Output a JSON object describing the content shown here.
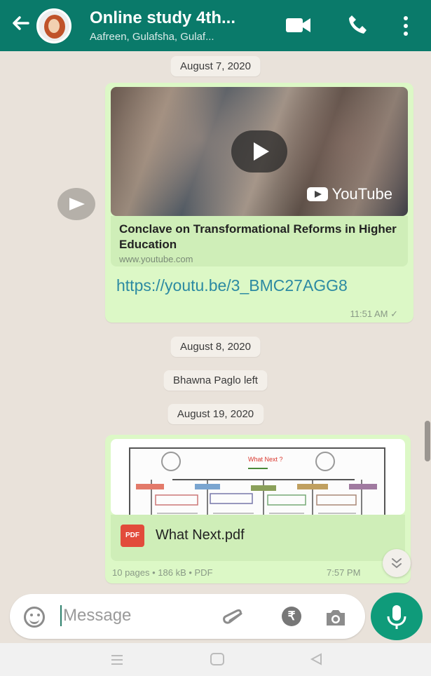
{
  "colors": {
    "header": "#0a7a6a",
    "bubble": "#dcf8c6",
    "mic": "#0f9b7a",
    "link": "#2c8aa2",
    "pdf": "#e24b3b"
  },
  "header": {
    "title": "Online study 4th...",
    "subtitle": "Aafreen, Gulafsha, Gulaf...",
    "icons": [
      "back-arrow-icon",
      "video-call-icon",
      "voice-call-icon",
      "more-options-icon"
    ]
  },
  "chat": {
    "date1": "August 7, 2020",
    "video_message": {
      "link_title": "Conclave on Transformational Reforms in Higher Education",
      "link_domain": "www.youtube.com",
      "url": "https://youtu.be/3_BMC27AGG8",
      "time": "11:51 AM ✓",
      "brand": "YouTube"
    },
    "date2": "August 8, 2020",
    "system_event": "Bhawna Paglo left",
    "date3": "August 19, 2020",
    "file_message": {
      "file_name": "What Next.pdf",
      "file_meta": "10 pages • 186 kB • PDF",
      "time": "7:57 PM",
      "icon_label": "PDF",
      "preview_title": "What Next ?"
    }
  },
  "composer": {
    "placeholder": "Message",
    "rupee_symbol": "₹"
  }
}
